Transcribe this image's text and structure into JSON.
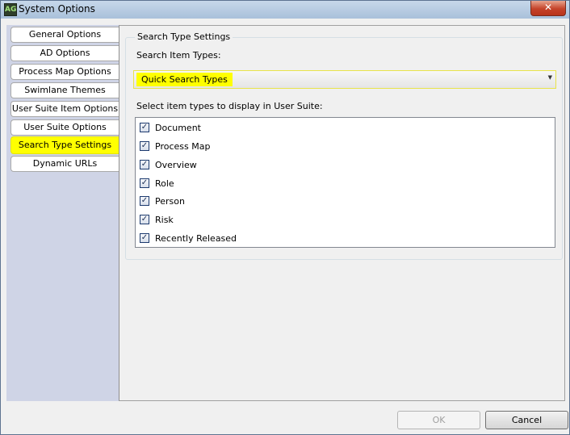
{
  "window": {
    "title": "System Options",
    "app_icon_text": "AG",
    "close_label": "✕"
  },
  "tabs": [
    {
      "label": "General Options",
      "active": false
    },
    {
      "label": "AD Options",
      "active": false
    },
    {
      "label": "Process Map Options",
      "active": false
    },
    {
      "label": "Swimlane Themes",
      "active": false
    },
    {
      "label": "User Suite Item Options",
      "active": false
    },
    {
      "label": "User Suite Options",
      "active": false
    },
    {
      "label": "Search Type Settings",
      "active": true
    },
    {
      "label": "Dynamic URLs",
      "active": false
    }
  ],
  "panel": {
    "group_title": "Search Type Settings",
    "item_types_label": "Search Item Types:",
    "combo_value": "Quick Search Types",
    "display_label": "Select item types to display in User Suite:",
    "items": [
      {
        "label": "Document",
        "checked": true
      },
      {
        "label": "Process Map",
        "checked": true
      },
      {
        "label": "Overview",
        "checked": true
      },
      {
        "label": "Role",
        "checked": true
      },
      {
        "label": "Person",
        "checked": true
      },
      {
        "label": "Risk",
        "checked": true
      },
      {
        "label": "Recently Released",
        "checked": true
      }
    ]
  },
  "buttons": {
    "ok": "OK",
    "cancel": "Cancel"
  },
  "colors": {
    "highlight": "#ffff00",
    "tab_background": "#cfd4e6"
  }
}
